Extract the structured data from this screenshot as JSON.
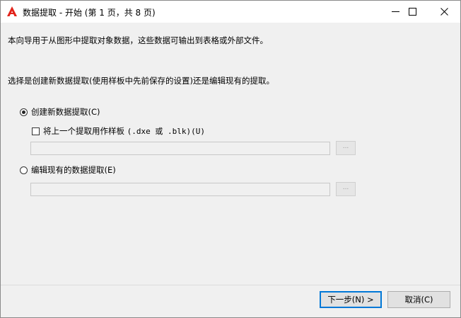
{
  "window": {
    "title": "数据提取 - 开始 (第 1 页，共 8 页)",
    "logo_text": "A",
    "brand_color": "#e2231a",
    "icons": {
      "app": "autocad-logo-icon",
      "minimize": "minimize-icon",
      "maximize": "maximize-icon",
      "close": "close-icon",
      "browse": "ellipsis-icon"
    }
  },
  "content": {
    "intro": "本向导用于从图形中提取对象数据，这些数据可输出到表格或外部文件。",
    "prompt": "选择是创建新数据提取(使用样板中先前保存的设置)还是编辑现有的提取。",
    "options": {
      "create_new": {
        "label": "创建新数据提取(C)",
        "selected": true
      },
      "use_template": {
        "label_prefix": "将上一个提取用作样板 ",
        "label_mono": "(.dxe 或 .blk)(U)",
        "checked": false,
        "path_value": "",
        "browse_label": "..."
      },
      "edit_existing": {
        "label": "编辑现有的数据提取(E)",
        "selected": false,
        "path_value": "",
        "browse_label": "..."
      }
    }
  },
  "buttons": {
    "next": "下一步(N) >",
    "cancel": "取消(C)"
  }
}
